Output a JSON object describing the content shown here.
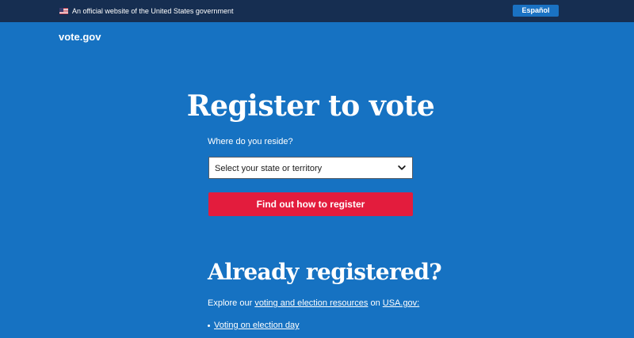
{
  "banner": {
    "text": "An official website of the United States government",
    "language_button": "Español"
  },
  "header": {
    "logo": "vote.gov"
  },
  "hero": {
    "title": "Register to vote",
    "state_label": "Where do you reside?",
    "state_select_value": "Select your state or territory",
    "register_button": "Find out how to register"
  },
  "registered": {
    "title": "Already registered?",
    "explore_prefix": "Explore our ",
    "resources_link": "voting and election resources",
    "explore_middle": " on ",
    "usagov_link": "USA.gov:",
    "items": [
      {
        "label": "Voting on election day"
      }
    ]
  },
  "colors": {
    "background": "#1672c2",
    "banner": "#162e51",
    "accent_button": "#e31c3d",
    "language_button": "#1a72c3"
  },
  "icons": {
    "flag": "us-flag-icon",
    "select": "chevron-down-icon"
  }
}
